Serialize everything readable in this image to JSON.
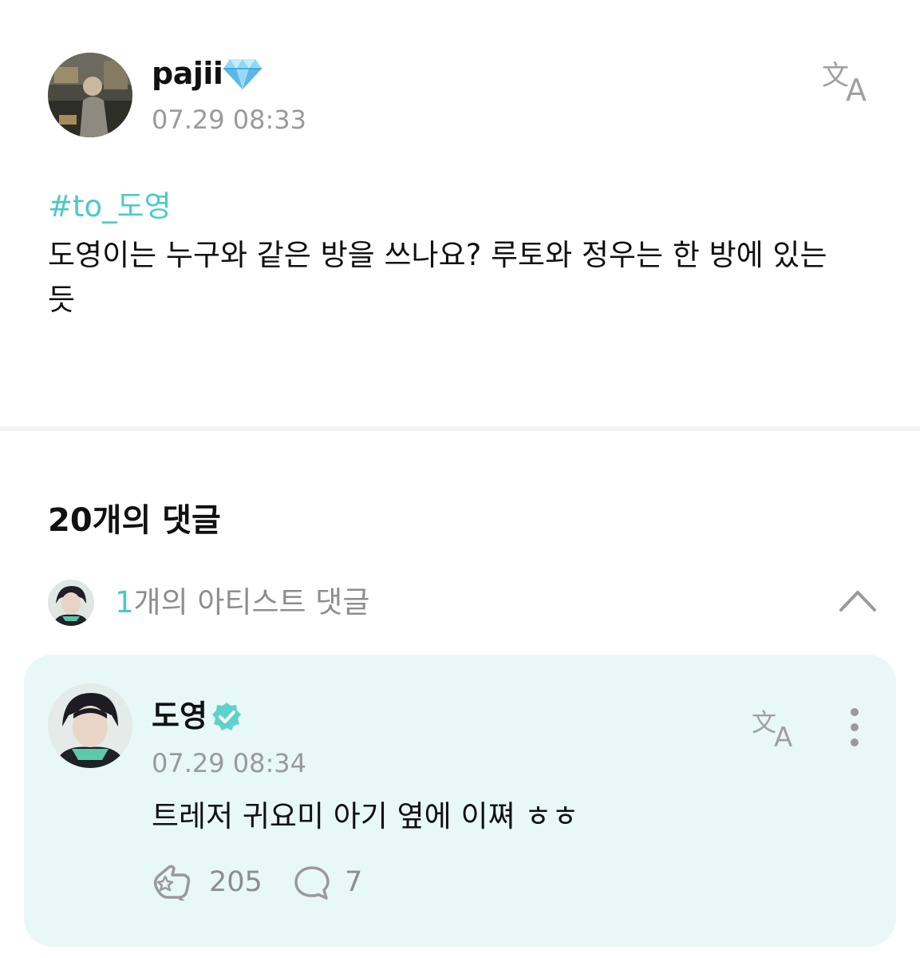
{
  "post": {
    "author": "pajii",
    "badge_icon": "gem-icon",
    "timestamp": "07.29 08:33",
    "tag": "#to_도영",
    "body": "도영이는 누구와 같은 방을 쓰나요? 루토와 정우는 한 방에 있는 듯",
    "translate_icon": "translate-icon"
  },
  "comments": {
    "count_label": "20개의 댓글",
    "artist_summary": {
      "count": "1",
      "label": "개의 아티스트 댓글",
      "toggle_icon": "chevron-up-icon"
    },
    "artist_comment": {
      "author": "도영",
      "verified_icon": "verified-icon",
      "timestamp": "07.29 08:34",
      "text": "트레저 귀요미 아기 옆에 이쪄 ㅎㅎ",
      "likes": "205",
      "replies": "7"
    }
  },
  "colors": {
    "accent": "#4cc9c6",
    "artist_card_bg": "#e8f8f6",
    "muted_text": "#9a9a9a"
  }
}
